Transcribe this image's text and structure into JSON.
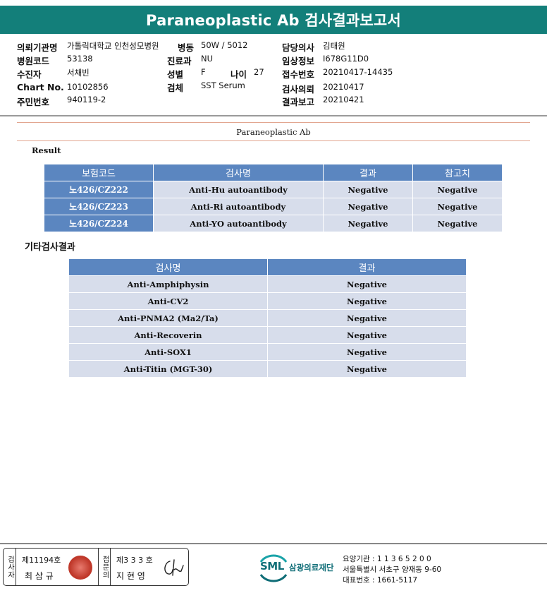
{
  "title": "Paraneoplastic Ab 검사결과보고서",
  "info": {
    "institution_label": "의뢰기관명",
    "institution": "가톨릭대학교 인천성모병원",
    "ward_label": "병동",
    "ward": "50W / 5012",
    "doctor_label": "담당의사",
    "doctor": "김태원",
    "hospital_code_label": "병원코드",
    "hospital_code": "53138",
    "department_label": "진료과",
    "department": "NU",
    "clinical_info_label": "임상정보",
    "clinical_info": "I678G11D0",
    "patient_label": "수진자",
    "patient": "서채빈",
    "sex_label": "성별",
    "sex": "F",
    "age_label": "나이",
    "age": "27",
    "receipt_no_label": "접수번호",
    "receipt_no": "20210417-14435",
    "chart_no_label": "Chart No.",
    "chart_no": "10102856",
    "specimen_label": "검체",
    "specimen": "SST Serum",
    "request_label": "검사의뢰",
    "request_date": "20210417",
    "id_no_label": "주민번호",
    "id_no": "940119-2",
    "report_label": "결과보고",
    "report_date": "20210421"
  },
  "section_title": "Paraneoplastic Ab",
  "result_label": "Result",
  "result_table": {
    "headers": [
      "보험코드",
      "검사명",
      "결과",
      "참고치"
    ],
    "rows": [
      {
        "code": "노426/CZ222",
        "test": "Anti-Hu autoantibody",
        "result": "Negative",
        "reference": "Negative"
      },
      {
        "code": "노426/CZ223",
        "test": "Anti-Ri autoantibody",
        "result": "Negative",
        "reference": "Negative"
      },
      {
        "code": "노426/CZ224",
        "test": "Anti-YO autoantibody",
        "result": "Negative",
        "reference": "Negative"
      }
    ]
  },
  "other_label": "기타검사결과",
  "other_table": {
    "headers": [
      "검사명",
      "결과"
    ],
    "rows": [
      {
        "test": "Anti-Amphiphysin",
        "result": "Negative"
      },
      {
        "test": "Anti-CV2",
        "result": "Negative"
      },
      {
        "test": "Anti-PNMA2 (Ma2/Ta)",
        "result": "Negative"
      },
      {
        "test": "Anti-Recoverin",
        "result": "Negative"
      },
      {
        "test": "Anti-SOX1",
        "result": "Negative"
      },
      {
        "test": "Anti-Titin (MGT-30)",
        "result": "Negative"
      }
    ]
  },
  "footer": {
    "tester_label": "검사자",
    "tester_license": "제11194호",
    "tester_name": "최 삼 규",
    "approver_label": "접문의",
    "approver_license": "제3 3 3 호",
    "approver_name": "지 현 영",
    "logo_abbr": "SML",
    "logo_name": "삼광의료재단",
    "care_no": "요양기관 : 1 1 3 6 5 2 0 0",
    "address": "서울특별시 서초구 양재동 9-60",
    "phone": "대표번호 : 1661-5117"
  },
  "colors": {
    "title_bar": "#137f7a",
    "table_header": "#5b86c0",
    "table_cell": "#d7ddeb",
    "seal": "#c0392b",
    "logo": "#0f6d77"
  }
}
